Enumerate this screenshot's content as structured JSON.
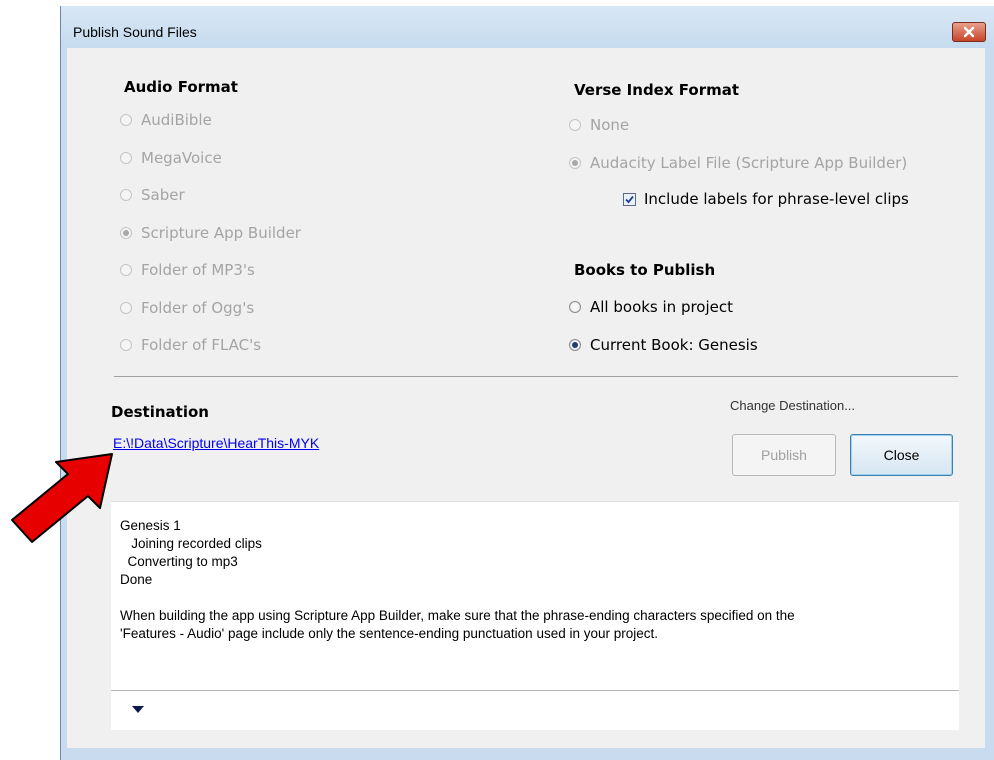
{
  "window": {
    "title": "Publish Sound Files"
  },
  "audio_format": {
    "heading": "Audio Format",
    "options": [
      {
        "label": "AudiBible",
        "selected": false,
        "enabled": false
      },
      {
        "label": "MegaVoice",
        "selected": false,
        "enabled": false
      },
      {
        "label": "Saber",
        "selected": false,
        "enabled": false
      },
      {
        "label": "Scripture App Builder",
        "selected": true,
        "enabled": false
      },
      {
        "label": "Folder of MP3's",
        "selected": false,
        "enabled": false
      },
      {
        "label": "Folder of Ogg's",
        "selected": false,
        "enabled": false
      },
      {
        "label": "Folder of FLAC's",
        "selected": false,
        "enabled": false
      }
    ]
  },
  "verse_index": {
    "heading": "Verse Index Format",
    "options": [
      {
        "label": "None",
        "selected": false,
        "enabled": false
      },
      {
        "label": "Audacity Label File (Scripture App Builder)",
        "selected": true,
        "enabled": false
      }
    ],
    "checkbox": {
      "label": "Include labels for phrase-level clips",
      "checked": true
    }
  },
  "books": {
    "heading": "Books to Publish",
    "options": [
      {
        "label": "All books in project",
        "selected": false,
        "enabled": true
      },
      {
        "label": "Current Book: Genesis",
        "selected": true,
        "enabled": true
      }
    ]
  },
  "destination": {
    "heading": "Destination",
    "path": "E:\\!Data\\Scripture\\HearThis-MYK",
    "change_label": "Change Destination..."
  },
  "buttons": {
    "publish": "Publish",
    "close": "Close"
  },
  "log": {
    "lines": [
      "Genesis 1",
      "   Joining recorded clips",
      "  Converting to mp3",
      "Done",
      "",
      "When building the app using Scripture App Builder, make sure that the phrase-ending characters specified on the",
      "'Features - Audio' page include only the sentence-ending punctuation used in your project."
    ]
  },
  "colors": {
    "link": "#0000ee",
    "arrow": "#e60000",
    "frame": "#c9dcef"
  },
  "icons": {
    "close": "close-x-icon",
    "expand": "triangle-down-icon",
    "annotation": "red-arrow-icon"
  }
}
